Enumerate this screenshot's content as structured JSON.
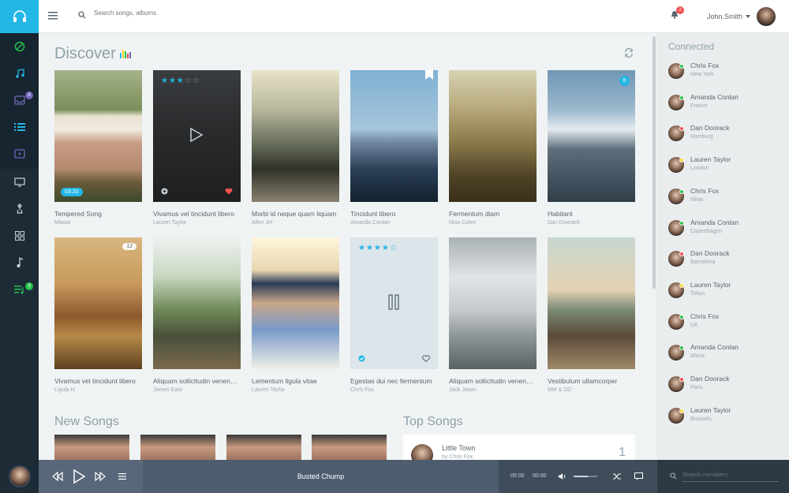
{
  "header": {
    "search_placeholder": "Search songs, albums...",
    "notification_count": "2",
    "username": "John.Smith"
  },
  "sidebar": {
    "items": [
      {
        "icon": "compass-icon"
      },
      {
        "icon": "music-note-icon"
      },
      {
        "icon": "inbox-icon",
        "badge": "6"
      },
      {
        "icon": "list-icon"
      },
      {
        "icon": "video-icon"
      },
      {
        "icon": "monitor-icon"
      },
      {
        "icon": "microphone-icon"
      },
      {
        "icon": "grid-icon"
      },
      {
        "icon": "note-icon"
      },
      {
        "icon": "playlist-icon",
        "badge": "9"
      }
    ]
  },
  "discover": {
    "title": "Discover",
    "cards": [
      {
        "title": "Tempered Song",
        "artist": "Miaow",
        "time": "03:20"
      },
      {
        "title": "Vivamus vel tincidunt libero",
        "artist": "Lauren Taylor"
      },
      {
        "title": "Morbi id neque quam liquam",
        "artist": "Allen JH"
      },
      {
        "title": "Tincidunt libero",
        "artist": "Amanda Conlan"
      },
      {
        "title": "Fermentum diam",
        "artist": "Nisa Colen"
      },
      {
        "title": "Habitant",
        "artist": "Dan Doorack",
        "count": "6"
      },
      {
        "title": "Vivamus vel tincidunt libero",
        "artist": "Ligula H",
        "count": "12"
      },
      {
        "title": "Aliquam sollicitudin venenatis",
        "artist": "James East"
      },
      {
        "title": "Lementum ligula vitae",
        "artist": "Lauren Taylor"
      },
      {
        "title": "Egestas dui nec fermentum",
        "artist": "Chris Fox"
      },
      {
        "title": "Aliquam sollicitudin venenatis",
        "artist": "Jack Jason"
      },
      {
        "title": "Vestibulum ullamcorper",
        "artist": "MM & DD"
      }
    ]
  },
  "new_songs": {
    "title": "New Songs"
  },
  "top_songs": {
    "title": "Top Songs",
    "items": [
      {
        "title": "Little Town",
        "artist": "by Chris Fox",
        "rank": "1"
      }
    ]
  },
  "connected": {
    "title": "Connected",
    "contacts": [
      {
        "name": "Chris Fox",
        "location": "New York",
        "status": "#27c24c"
      },
      {
        "name": "Amanda Conlan",
        "location": "France",
        "status": "#27c24c"
      },
      {
        "name": "Dan Doorack",
        "location": "Hamburg",
        "status": "#f05050"
      },
      {
        "name": "Lauren Taylor",
        "location": "London",
        "status": "#fad733"
      },
      {
        "name": "Chris Fox",
        "location": "Milan",
        "status": "#27c24c"
      },
      {
        "name": "Amanda Conlan",
        "location": "Copenhagen",
        "status": "#27c24c"
      },
      {
        "name": "Dan Doorack",
        "location": "Barcelona",
        "status": "#f05050"
      },
      {
        "name": "Lauren Taylor",
        "location": "Tokyo",
        "status": "#fad733"
      },
      {
        "name": "Chris Fox",
        "location": "UK",
        "status": "#27c24c"
      },
      {
        "name": "Amanda Conlan",
        "location": "Africa",
        "status": "#27c24c"
      },
      {
        "name": "Dan Doorack",
        "location": "Paris",
        "status": "#f05050"
      },
      {
        "name": "Lauren Taylor",
        "location": "Brussels",
        "status": "#fad733"
      }
    ]
  },
  "player": {
    "track": "Busted Chump",
    "current_time": "00:00",
    "duration": "00:00",
    "volume_level": 0.6,
    "members_placeholder": "Search members"
  },
  "colors": {
    "accent": "#23b7e5",
    "sidebar": "#1c2b36",
    "player": "#4d5d6e"
  }
}
